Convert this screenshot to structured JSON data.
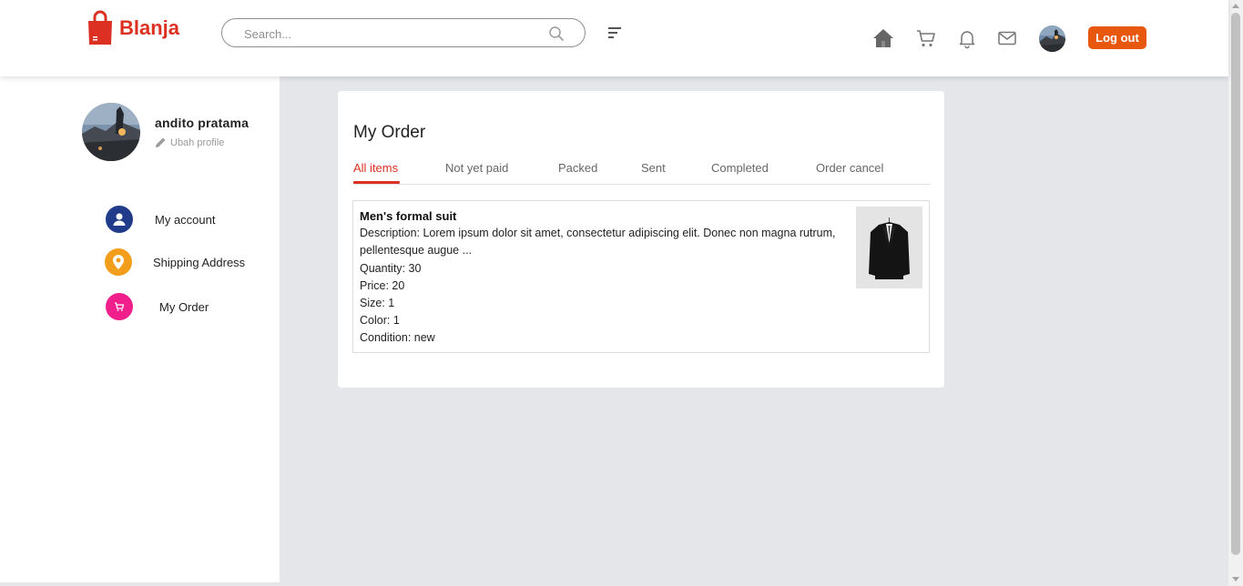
{
  "header": {
    "brand": "Blanja",
    "search_placeholder": "Search...",
    "logout_label": "Log out"
  },
  "icons": {
    "logo": "shopping-bag-icon",
    "search": "search-icon",
    "filter": "filter-icon",
    "home": "home-icon",
    "cart": "cart-icon",
    "notifications": "bell-icon",
    "messages": "mail-icon"
  },
  "profile": {
    "name": "andito pratama",
    "edit_label": "Ubah profile"
  },
  "sidebar": {
    "items": [
      {
        "label": "My account",
        "icon": "user-icon",
        "color": "#1f3b8a"
      },
      {
        "label": "Shipping Address",
        "icon": "map-pin-icon",
        "color": "#f29e1c"
      },
      {
        "label": "My Order",
        "icon": "cart-icon",
        "color": "#f01f8c"
      }
    ]
  },
  "main": {
    "title": "My Order",
    "tabs": [
      "All items",
      "Not yet paid",
      "Packed",
      "Sent",
      "Completed",
      "Order cancel"
    ],
    "active_tab": "All items",
    "orders": [
      {
        "name": "Men's formal suit",
        "description": "Description: Lorem ipsum dolor sit amet, consectetur adipiscing elit. Donec non magna rutrum, pellentesque augue ...",
        "quantity": "Quantity: 30",
        "price": "Price: 20",
        "size": "Size: 1",
        "color": "Color: 1",
        "condition": "Condition: new"
      }
    ]
  },
  "colors": {
    "brand": "#db3022",
    "logout": "#e8570e",
    "page_bg": "#e5e6ea"
  }
}
